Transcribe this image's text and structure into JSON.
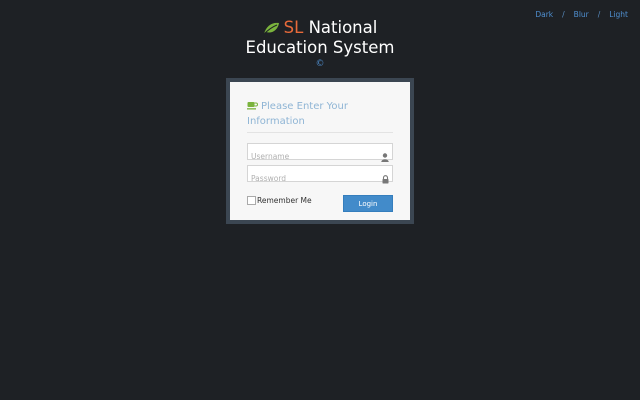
{
  "theme_switch": {
    "items": [
      "Dark",
      "Blur",
      "Light"
    ],
    "separator": "/"
  },
  "brand": {
    "prefix": "SL",
    "line1_rest": " National",
    "line2": "Education System",
    "icon": "leaf-icon"
  },
  "copyright": "©",
  "login": {
    "title": "Please Enter Your Information",
    "title_icon": "coffee-cup-icon",
    "username_placeholder": "Username",
    "password_placeholder": "Password",
    "username_icon": "user-icon",
    "password_icon": "lock-icon",
    "remember_label": "Remember Me",
    "submit_label": "Login"
  },
  "colors": {
    "background": "#1e2125",
    "accent": "#428bca",
    "brand_orange": "#e86a3a",
    "leaf_green": "#7ab33d",
    "title_blue": "#8fb5d5"
  }
}
